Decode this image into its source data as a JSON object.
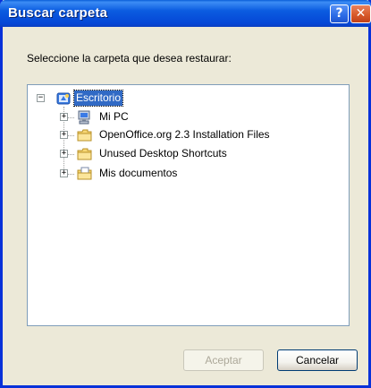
{
  "window": {
    "title": "Buscar carpeta",
    "help_glyph": "?",
    "close_glyph": "✕"
  },
  "dialog": {
    "prompt": "Seleccione la carpeta que desea restaurar:"
  },
  "tree": {
    "root": {
      "label": "Escritorio",
      "icon": "desktop-icon",
      "expander": "−",
      "selected": true
    },
    "children": [
      {
        "label": "Mi PC",
        "icon": "computer-icon",
        "expander": "+"
      },
      {
        "label": "OpenOffice.org 2.3 Installation Files",
        "icon": "folder-icon",
        "expander": "+"
      },
      {
        "label": "Unused Desktop Shortcuts",
        "icon": "folder-icon",
        "expander": "+"
      },
      {
        "label": "Mis documentos",
        "icon": "documents-folder-icon",
        "expander": "+"
      }
    ]
  },
  "buttons": {
    "ok_label": "Aceptar",
    "ok_enabled": false,
    "cancel_label": "Cancelar"
  },
  "colors": {
    "titlebar": "#0b5ce0",
    "dialog_bg": "#ece9d8",
    "selection": "#316ac5",
    "close_button": "#d85a2b"
  }
}
